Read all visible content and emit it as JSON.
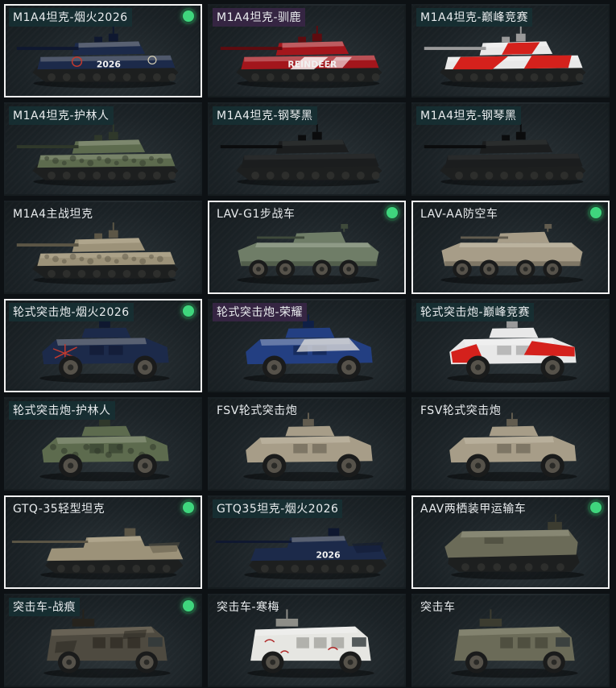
{
  "colors": {
    "accent_green": "#3fd67d",
    "selected_border": "#f2f2f2",
    "label_bg": "#163034",
    "label_bg_special": "#382646"
  },
  "vehicles": [
    {
      "name": "M1A4坦克-烟火2026",
      "type": "tank",
      "scheme": "firework",
      "selected": true,
      "equipped": true,
      "label_style": "teal",
      "decal": "2026"
    },
    {
      "name": "M1A4坦克-驯鹿",
      "type": "tank",
      "scheme": "reindeer",
      "selected": false,
      "equipped": false,
      "label_style": "purple",
      "decal": "REINDEER"
    },
    {
      "name": "M1A4坦克-巅峰竞赛",
      "type": "tank",
      "scheme": "racing",
      "selected": false,
      "equipped": false,
      "label_style": "teal",
      "decal": ""
    },
    {
      "name": "M1A4坦克-护林人",
      "type": "tank",
      "scheme": "forest",
      "selected": false,
      "equipped": false,
      "label_style": "teal",
      "decal": ""
    },
    {
      "name": "M1A4坦克-钢琴黑",
      "type": "tank",
      "scheme": "black",
      "selected": false,
      "equipped": false,
      "label_style": "teal",
      "decal": ""
    },
    {
      "name": "M1A4坦克-钢琴黑",
      "type": "tank",
      "scheme": "black",
      "selected": false,
      "equipped": false,
      "label_style": "teal",
      "decal": ""
    },
    {
      "name": "M1A4主战坦克",
      "type": "tank",
      "scheme": "desert",
      "selected": false,
      "equipped": false,
      "label_style": "plain",
      "decal": ""
    },
    {
      "name": "LAV-G1步战车",
      "type": "apc",
      "scheme": "green",
      "selected": true,
      "equipped": true,
      "label_style": "plain",
      "decal": ""
    },
    {
      "name": "LAV-AA防空车",
      "type": "apc",
      "scheme": "tan",
      "selected": true,
      "equipped": true,
      "label_style": "plain",
      "decal": ""
    },
    {
      "name": "轮式突击炮-烟火2026",
      "type": "truck",
      "scheme": "firework",
      "selected": true,
      "equipped": true,
      "label_style": "teal",
      "decal": ""
    },
    {
      "name": "轮式突击炮-荣耀",
      "type": "truck",
      "scheme": "glory",
      "selected": false,
      "equipped": false,
      "label_style": "purple",
      "decal": ""
    },
    {
      "name": "轮式突击炮-巅峰竞赛",
      "type": "truck",
      "scheme": "racing",
      "selected": false,
      "equipped": false,
      "label_style": "teal",
      "decal": ""
    },
    {
      "name": "轮式突击炮-护林人",
      "type": "truck",
      "scheme": "forest",
      "selected": false,
      "equipped": false,
      "label_style": "teal",
      "decal": ""
    },
    {
      "name": "FSV轮式突击炮",
      "type": "truck",
      "scheme": "tan",
      "selected": false,
      "equipped": false,
      "label_style": "plain",
      "decal": ""
    },
    {
      "name": "FSV轮式突击炮",
      "type": "truck",
      "scheme": "tan",
      "selected": false,
      "equipped": false,
      "label_style": "plain",
      "decal": ""
    },
    {
      "name": "GTQ-35轻型坦克",
      "type": "light",
      "scheme": "desert",
      "selected": true,
      "equipped": true,
      "label_style": "plain",
      "decal": ""
    },
    {
      "name": "GTQ35坦克-烟火2026",
      "type": "light",
      "scheme": "firework",
      "selected": false,
      "equipped": false,
      "label_style": "teal",
      "decal": "2026"
    },
    {
      "name": "AAV两栖装甲运输车",
      "type": "amphib",
      "scheme": "olive",
      "selected": true,
      "equipped": true,
      "label_style": "plain",
      "decal": ""
    },
    {
      "name": "突击车-战痕",
      "type": "mrap",
      "scheme": "worn",
      "selected": false,
      "equipped": true,
      "label_style": "teal",
      "decal": ""
    },
    {
      "name": "突击车-寒梅",
      "type": "mrap",
      "scheme": "white",
      "selected": false,
      "equipped": false,
      "label_style": "plain",
      "decal": ""
    },
    {
      "name": "突击车",
      "type": "mrap",
      "scheme": "olive",
      "selected": false,
      "equipped": false,
      "label_style": "plain",
      "decal": ""
    }
  ]
}
